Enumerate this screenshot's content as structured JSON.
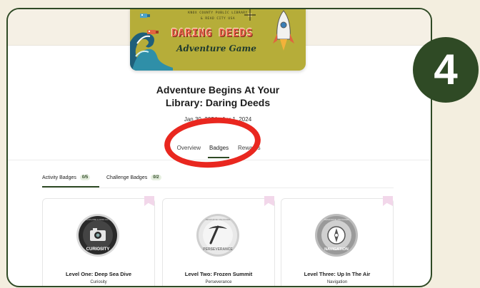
{
  "banner": {
    "library_line1": "KNOX COUNTY PUBLIC LIBRARY",
    "library_line2": "& READ CITY USA",
    "title": "DARING DEEDS",
    "subtitle": "Adventure Game"
  },
  "page": {
    "title": "Adventure Begins At Your Library: Daring Deeds",
    "dates": "Jan 30, 2024 - Apr 1, 2024"
  },
  "tabs": [
    {
      "label": "Overview",
      "active": false
    },
    {
      "label": "Badges",
      "active": true
    },
    {
      "label": "Rewards",
      "active": false
    }
  ],
  "subtabs": [
    {
      "label": "Activity Badges",
      "count": "0/5",
      "active": true
    },
    {
      "label": "Challenge Badges",
      "count": "0/2",
      "active": false
    }
  ],
  "badges": [
    {
      "title": "Level One: Deep Sea Dive",
      "subtitle": "Curiosity",
      "badge_text": "CURIOSITY",
      "badge_top": "EXPLORE & FIND OUT",
      "icon": "camera-icon"
    },
    {
      "title": "Level Two: Frozen Summit",
      "subtitle": "Perseverance",
      "badge_text": "PERSEVERANCE",
      "badge_top": "RESOURCE UNLOCKED",
      "icon": "pickaxe-icon"
    },
    {
      "title": "Level Three: Up In The Air",
      "subtitle": "Navigation",
      "badge_text": "NAVIGATION",
      "badge_top": "RESOURCE UNLOCKED",
      "icon": "compass-icon"
    }
  ],
  "step_number": "4",
  "colors": {
    "accent": "#2f4a25",
    "highlight": "#e9271f",
    "background": "#f3eedf",
    "banner": "#b6ad39"
  }
}
